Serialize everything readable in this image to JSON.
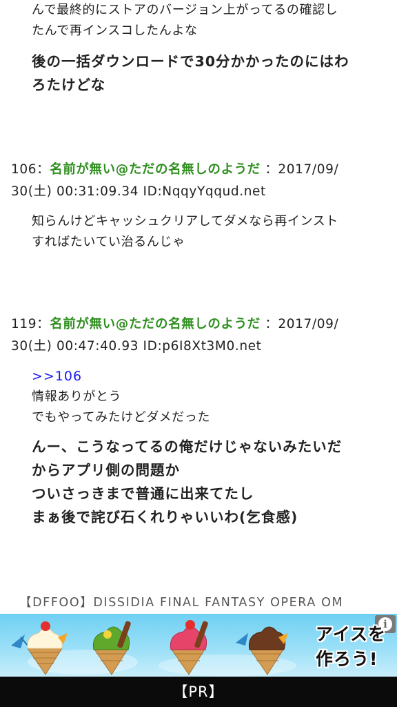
{
  "prev_post": {
    "small_lines": [
      "んで最終的にストアのバージョン上がってるの確認し",
      "たんで再インスコしたんよな"
    ],
    "big_lines": [
      "後の一括ダウンロードで30分かかったのにはわ",
      "ろたけどな"
    ]
  },
  "posts": [
    {
      "number": "106",
      "separator": "：",
      "name": "名前が無い@ただの名無しのようだ",
      "date_part1": "：2017/09/",
      "date_part2": "30(土) 00:31:09.34 ID:NqqyYqqud.net",
      "lines": [
        "知らんけどキャッシュクリアしてダメなら再インスト",
        "すればたいてい治るんじゃ"
      ]
    },
    {
      "number": "119",
      "separator": "：",
      "name": "名前が無い@ただの名無しのようだ",
      "date_part1": "：2017/09/",
      "date_part2": "30(土) 00:47:40.93 ID:p6I8Xt3M0.net",
      "anchor": ">>106",
      "small_lines": [
        "情報ありがとう",
        "でもやってみたけどダメだった"
      ],
      "big_lines": [
        "んー、こうなってるの俺だけじゃないみたいだ",
        "からアプリ側の問題か",
        "ついさっきまで普通に出来てたし",
        "まぁ後で詫び石くれりゃいいわ(乞食感)"
      ]
    }
  ],
  "ad": {
    "title": "【DFFOO】DISSIDIA FINAL FANTASY OPERA OM",
    "banner_line1": "アイスを",
    "banner_line2": "作ろう!",
    "info_icon": "i",
    "colors": {
      "sky": "#8fdcf6",
      "cone": "#d9a35a"
    }
  },
  "pr_bar": {
    "label": "【PR】"
  }
}
